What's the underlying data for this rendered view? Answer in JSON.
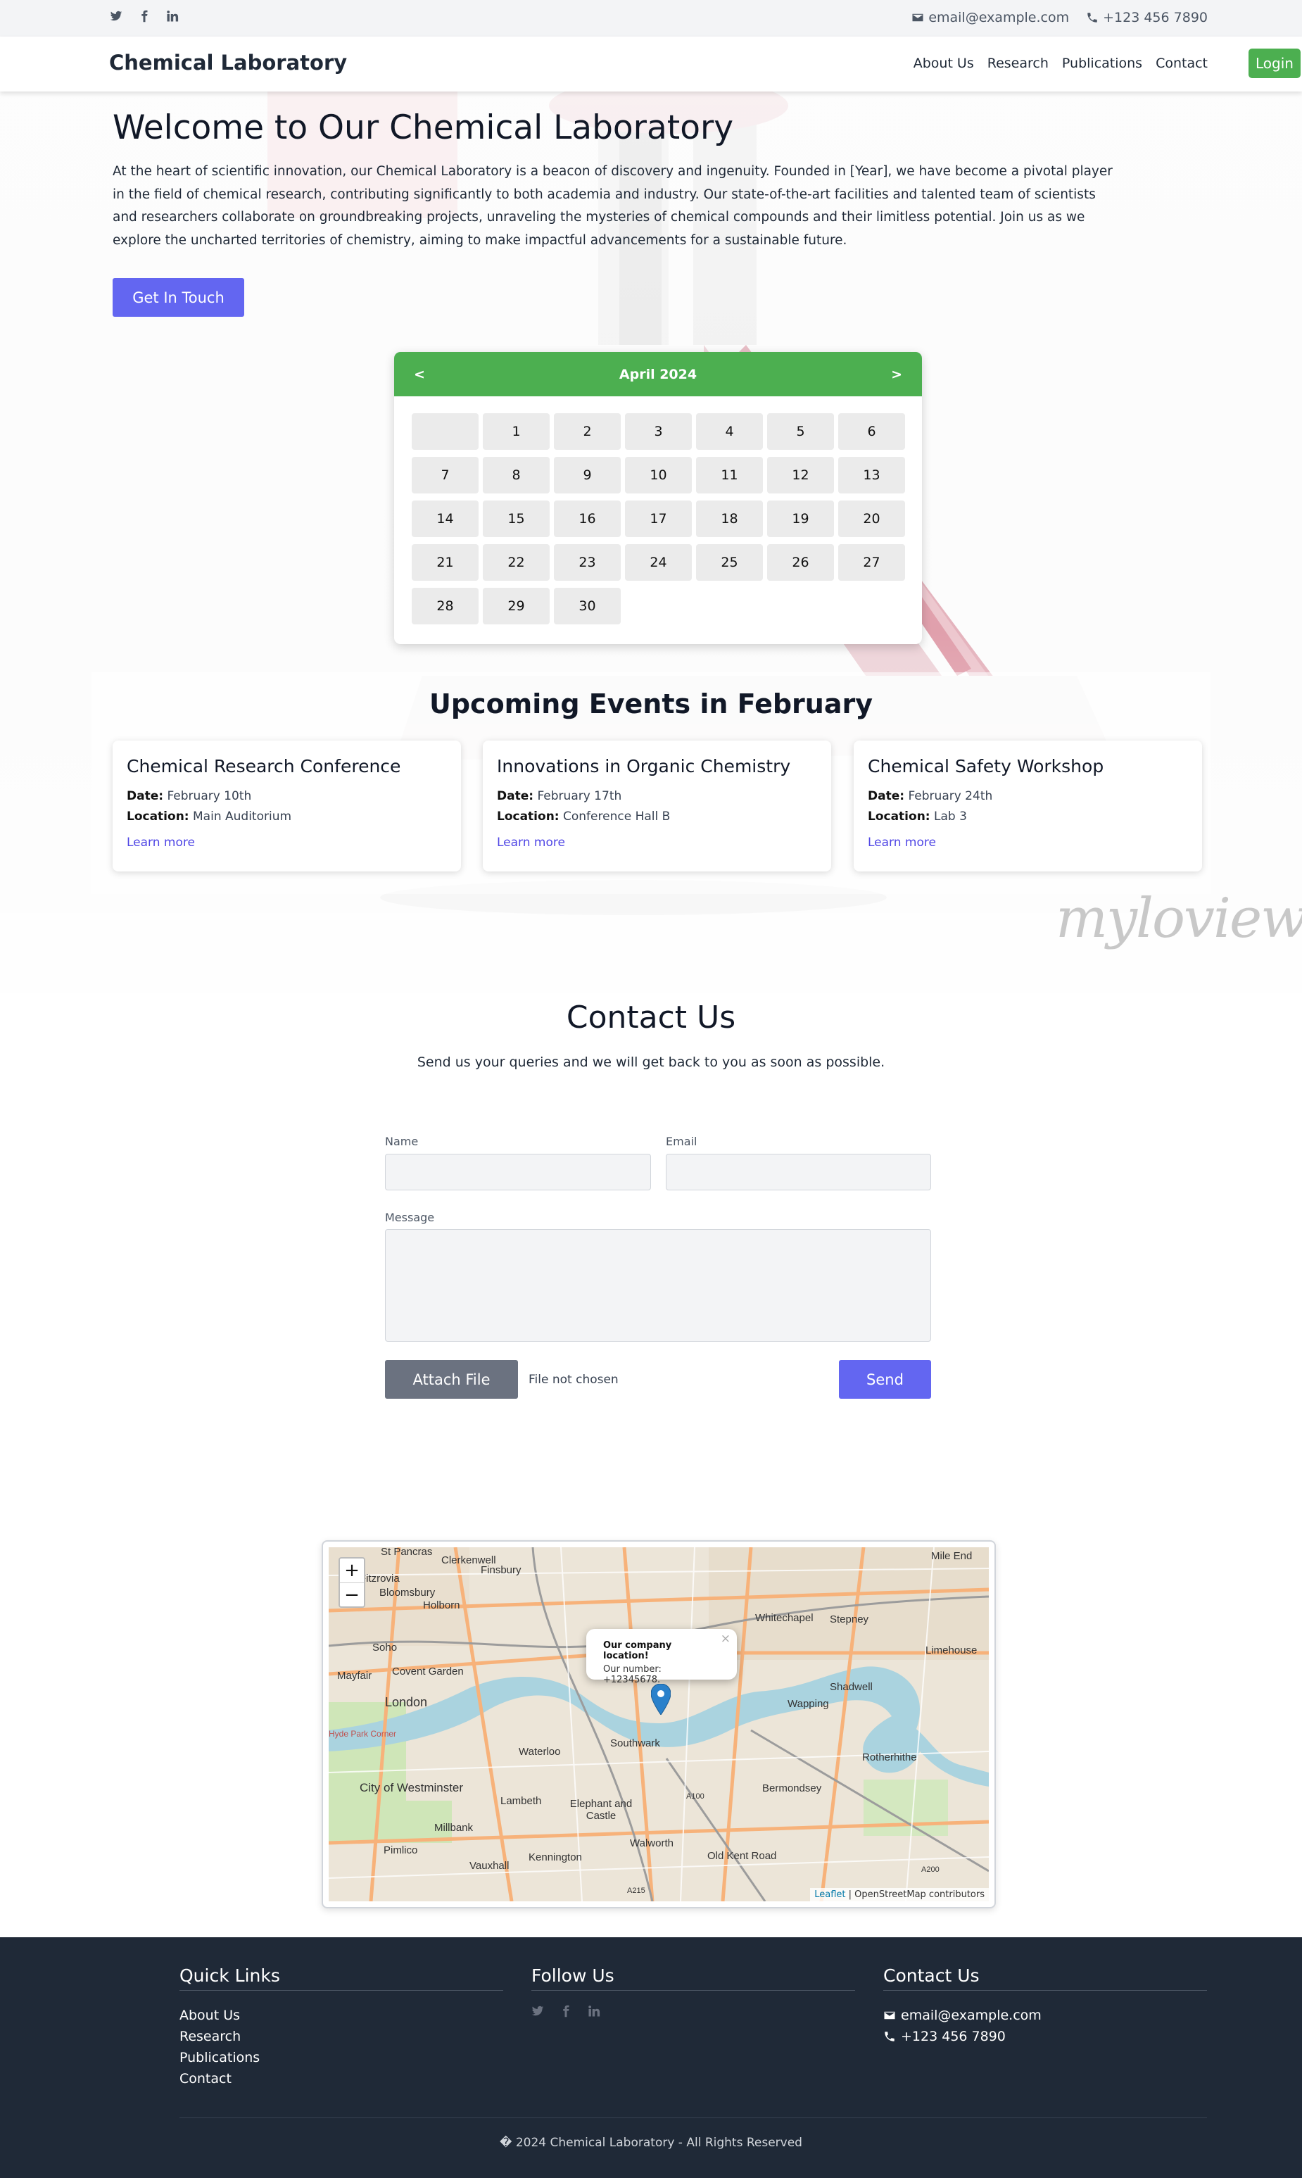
{
  "topbar": {
    "email": "email@example.com",
    "phone": "+123 456 7890",
    "social": [
      "twitter-icon",
      "facebook-icon",
      "linkedin-icon"
    ]
  },
  "nav": {
    "brand": "Chemical Laboratory",
    "items": [
      "About Us",
      "Research",
      "Publications",
      "Contact"
    ],
    "login": "Login"
  },
  "hero": {
    "title": "Welcome to Our Chemical Laboratory",
    "text": "At the heart of scientific innovation, our Chemical Laboratory is a beacon of discovery and ingenuity. Founded in [Year], we have become a pivotal player in the field of chemical research, contributing significantly to both academia and industry. Our state-of-the-art facilities and talented team of scientists and researchers collaborate on groundbreaking projects, unraveling the mysteries of chemical compounds and their limitless potential. Join us as we explore the uncharted territories of chemistry, aiming to make impactful advancements for a sustainable future.",
    "cta": "Get In Touch"
  },
  "calendar": {
    "month": "April 2024",
    "prev": "<",
    "next": ">",
    "leading_blanks": 1,
    "days": 30
  },
  "events": {
    "title": "Upcoming Events in February",
    "date_label": "Date:",
    "location_label": "Location:",
    "items": [
      {
        "name": "Chemical Research Conference",
        "date": "February 10th",
        "location": "Main Auditorium",
        "link": "Learn more"
      },
      {
        "name": "Innovations in Organic Chemistry",
        "date": "February 17th",
        "location": "Conference Hall B",
        "link": "Learn more"
      },
      {
        "name": "Chemical Safety Workshop",
        "date": "February 24th",
        "location": "Lab 3",
        "link": "Learn more"
      }
    ]
  },
  "watermark": "myloview",
  "contact": {
    "title": "Contact Us",
    "subtitle": "Send us your queries and we will get back to you as soon as possible.",
    "name_label": "Name",
    "email_label": "Email",
    "message_label": "Message",
    "name_value": "",
    "email_value": "",
    "message_value": "",
    "attach": "Attach File",
    "file_status": "File not chosen",
    "send": "Send"
  },
  "map": {
    "zoom_in": "+",
    "zoom_out": "−",
    "popup_title": "Our company location!",
    "popup_text": "Our number: +12345678.",
    "popup_close": "×",
    "attribution_link": "Leaflet",
    "attribution_text": " | OpenStreetMap contributors",
    "labels": [
      "St Pancras",
      "Clerkenwell",
      "Finsbury",
      "Mile End",
      "Fitzrovia",
      "Bloomsbury",
      "Holborn",
      "Whitechapel",
      "Stepney",
      "Soho",
      "Limehouse",
      "Mayfair",
      "Covent Garden",
      "Wapping",
      "Shadwell",
      "London",
      "Southwark",
      "Rotherhithe",
      "Hyde Park Corner",
      "Waterloo",
      "City of Westminster",
      "Lambeth",
      "Elephant and Castle",
      "Bermondsey",
      "A100",
      "Millbank",
      "Walworth",
      "Old Kent Road",
      "Pimlico",
      "Kennington",
      "Vauxhall",
      "A215",
      "A200"
    ]
  },
  "footer": {
    "quick_title": "Quick Links",
    "quick_links": [
      "About Us",
      "Research",
      "Publications",
      "Contact"
    ],
    "follow_title": "Follow Us",
    "contact_title": "Contact Us",
    "email": "email@example.com",
    "phone": "+123 456 7890",
    "copyright": "� 2024 Chemical Laboratory - All Rights Reserved"
  },
  "colors": {
    "accent": "#6366f1",
    "green": "#4caf50",
    "footer": "#1f2937"
  }
}
